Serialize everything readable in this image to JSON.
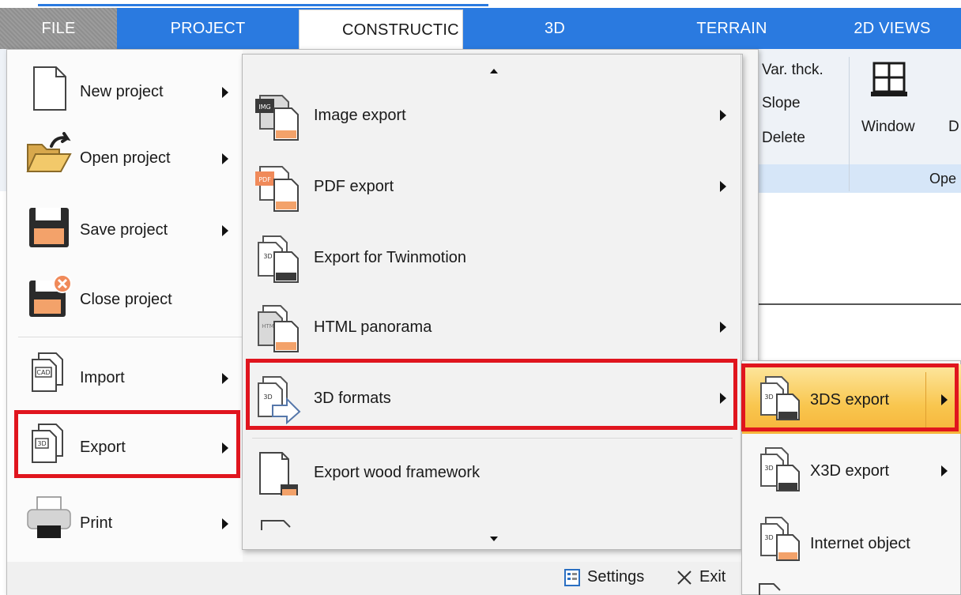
{
  "tabs": [
    {
      "key": "file",
      "label": "FILE"
    },
    {
      "key": "project",
      "label": "PROJECT"
    },
    {
      "key": "construction",
      "label": "CONSTRUCTIC"
    },
    {
      "key": "t3d",
      "label": "3D"
    },
    {
      "key": "terrain",
      "label": "TERRAIN"
    },
    {
      "key": "views",
      "label": "2D VIEWS"
    }
  ],
  "ribbon": {
    "var_thickness": "Var. thck.",
    "slope": "Slope",
    "delete": "Delete",
    "window": "Window",
    "door_partial": "D",
    "group_label_partial": "Ope"
  },
  "file_menu": {
    "items": [
      {
        "label": "New project",
        "icon": "new-document-icon"
      },
      {
        "label": "Open project",
        "icon": "open-folder-icon"
      },
      {
        "label": "Save project",
        "icon": "floppy-disk-icon"
      },
      {
        "label": "Close project",
        "icon": "close-project-icon"
      },
      {
        "label": "Import",
        "icon": "cad-import-icon"
      },
      {
        "label": "Export",
        "icon": "export-icon"
      },
      {
        "label": "Print",
        "icon": "printer-icon"
      }
    ],
    "settings": "Settings",
    "exit": "Exit"
  },
  "export_menu": {
    "items": [
      {
        "label": "Image export",
        "badge": "IMG"
      },
      {
        "label": "PDF export",
        "badge": "PDF"
      },
      {
        "label": "Export for Twinmotion",
        "badge": "3D"
      },
      {
        "label": "HTML panorama",
        "badge": "HTM"
      },
      {
        "label": "3D formats",
        "badge": "3D"
      },
      {
        "label": "Export wood framework",
        "badge": ""
      }
    ]
  },
  "formats_menu": {
    "items": [
      {
        "label": "3DS export",
        "badge": "3D"
      },
      {
        "label": "X3D export",
        "badge": "3D"
      },
      {
        "label": "Internet object",
        "badge": "3D"
      }
    ]
  },
  "colors": {
    "ribbon_blue": "#2a7ae0",
    "highlight_red": "#e0151e",
    "hover_orange": "#f9c64e"
  }
}
